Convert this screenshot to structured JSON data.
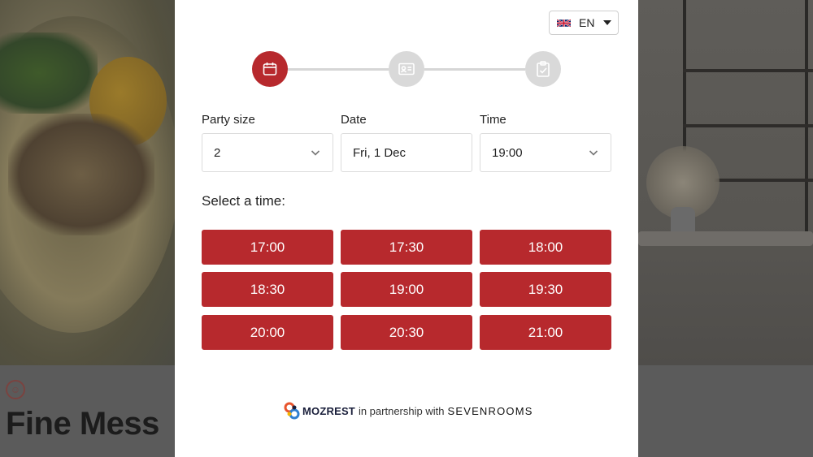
{
  "background": {
    "restaurant_name": "Fine Mess",
    "brand_icon": "restaurant-logo-icon"
  },
  "language": {
    "code": "EN",
    "flag_icon": "uk-flag-icon"
  },
  "stepper": {
    "steps": [
      {
        "icon": "calendar-icon",
        "state": "active"
      },
      {
        "icon": "contact-card-icon",
        "state": "inactive"
      },
      {
        "icon": "clipboard-check-icon",
        "state": "inactive"
      }
    ]
  },
  "form": {
    "party_size": {
      "label": "Party size",
      "value": "2"
    },
    "date": {
      "label": "Date",
      "value": "Fri, 1 Dec"
    },
    "time": {
      "label": "Time",
      "value": "19:00"
    }
  },
  "select_time_title": "Select a time:",
  "time_slots": [
    "17:00",
    "17:30",
    "18:00",
    "18:30",
    "19:00",
    "19:30",
    "20:00",
    "20:30",
    "21:00"
  ],
  "footer": {
    "brand": "MOZREST",
    "partner_text": "in partnership with",
    "partner_brand": "SEVENROOMS"
  },
  "colors": {
    "accent": "#b7292d",
    "inactive_step": "#d9d9d9"
  }
}
